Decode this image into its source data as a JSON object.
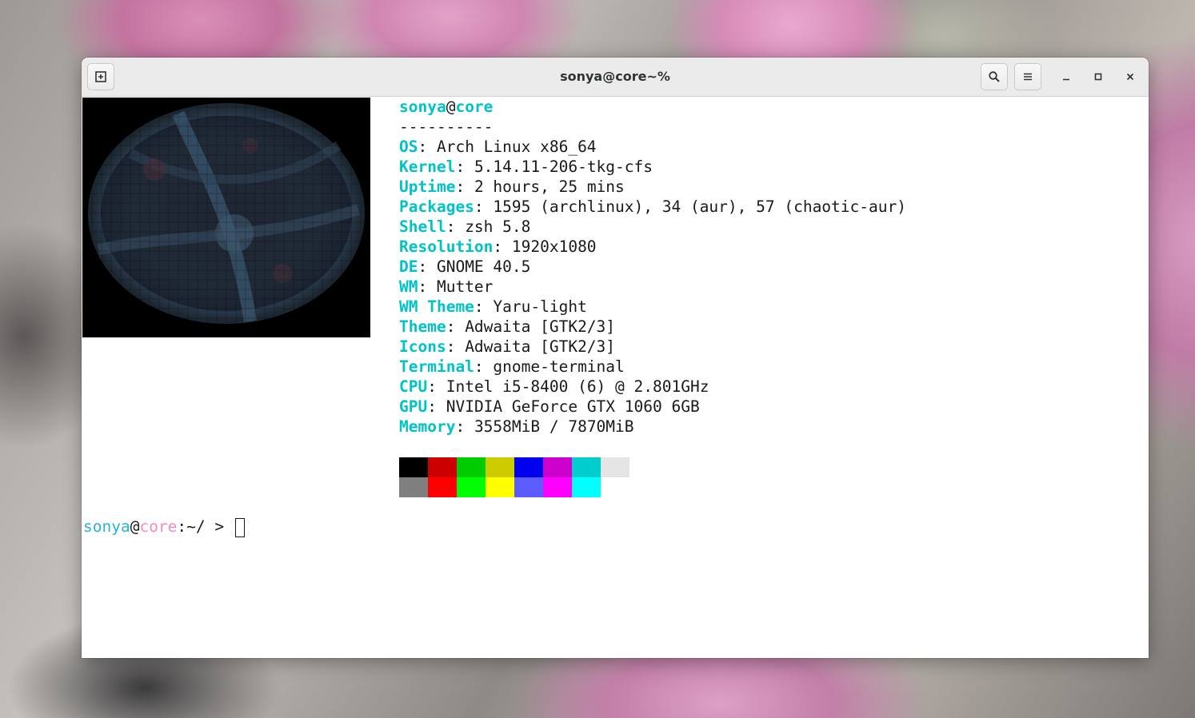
{
  "window": {
    "title": "sonya@core~%",
    "icons": {
      "new_tab": "new-tab-icon",
      "search": "search-icon",
      "menu": "hamburger-menu-icon",
      "minimize": "minimize-icon",
      "maximize": "maximize-icon",
      "close": "close-icon"
    }
  },
  "neofetch": {
    "user": "sonya",
    "at": "@",
    "host": "core",
    "separator": "----------",
    "fields": [
      {
        "key": "OS",
        "value": "Arch Linux x86_64"
      },
      {
        "key": "Kernel",
        "value": "5.14.11-206-tkg-cfs"
      },
      {
        "key": "Uptime",
        "value": "2 hours, 25 mins"
      },
      {
        "key": "Packages",
        "value": "1595 (archlinux), 34 (aur), 57 (chaotic-aur)"
      },
      {
        "key": "Shell",
        "value": "zsh 5.8"
      },
      {
        "key": "Resolution",
        "value": "1920x1080"
      },
      {
        "key": "DE",
        "value": "GNOME 40.5"
      },
      {
        "key": "WM",
        "value": "Mutter"
      },
      {
        "key": "WM Theme",
        "value": "Yaru-light"
      },
      {
        "key": "Theme",
        "value": "Adwaita [GTK2/3]"
      },
      {
        "key": "Icons",
        "value": "Adwaita [GTK2/3]"
      },
      {
        "key": "Terminal",
        "value": "gnome-terminal"
      },
      {
        "key": "CPU",
        "value": "Intel i5-8400 (6) @ 2.801GHz"
      },
      {
        "key": "GPU",
        "value": "NVIDIA GeForce GTX 1060 6GB"
      },
      {
        "key": "Memory",
        "value": "3558MiB / 7870MiB"
      }
    ],
    "palette": {
      "normal": [
        "#000000",
        "#cc0000",
        "#00cc00",
        "#cccc00",
        "#0000ee",
        "#cd00cd",
        "#00cdcd",
        "#e5e5e5"
      ],
      "bright": [
        "#7f7f7f",
        "#ff0000",
        "#00ff00",
        "#ffff00",
        "#5c5cff",
        "#ff00ff",
        "#00ffff",
        "#ffffff"
      ]
    }
  },
  "prompt": {
    "user": "sonya",
    "at": "@",
    "host": "core",
    "path": ":~/ > "
  },
  "colors": {
    "key_cyan": "#00c2c7",
    "prompt_user": "#27b4d6",
    "prompt_host": "#f28ac0"
  }
}
